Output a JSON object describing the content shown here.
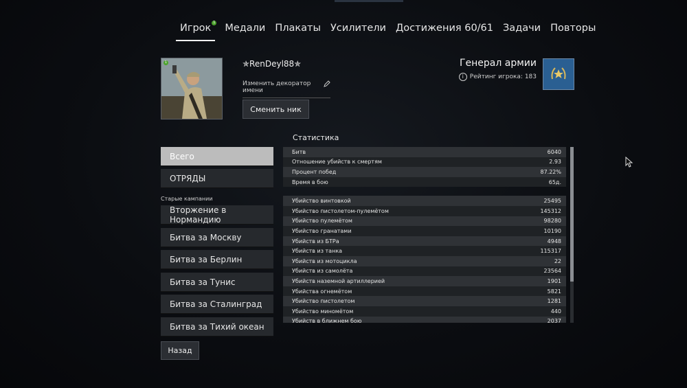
{
  "nav": {
    "tabs": [
      {
        "label": "Игрок",
        "active": true,
        "notification": "1"
      },
      {
        "label": "Медали"
      },
      {
        "label": "Плакаты"
      },
      {
        "label": "Усилители"
      },
      {
        "label": "Достижения 60/61"
      },
      {
        "label": "Задачи"
      },
      {
        "label": "Повторы"
      }
    ]
  },
  "profile": {
    "avatar_badge": "1",
    "username": "✯RenDeyl88✯",
    "decorator_label": "Изменить декоратор имени",
    "change_nick_label": "Сменить ник",
    "rank_title": "Генерал армии",
    "rating_text": "Рейтинг игрока: 183",
    "rank_color": "#2a5f92"
  },
  "sidebar": {
    "items": [
      {
        "label": "Всего",
        "active": true
      },
      {
        "label": "ОТРЯДЫ"
      }
    ],
    "old_campaigns_heading": "Старые кампании",
    "campaigns": [
      {
        "label": "Вторжение в Нормандию"
      },
      {
        "label": "Битва за Москву"
      },
      {
        "label": "Битва за Берлин"
      },
      {
        "label": "Битва за Тунис"
      },
      {
        "label": "Битва за Сталинград"
      },
      {
        "label": "Битва за Тихий океан"
      }
    ],
    "back_label": "Назад"
  },
  "stats": {
    "title": "Статистика",
    "group1": [
      {
        "label": "Битв",
        "value": "6040"
      },
      {
        "label": "Отношение убийств к смертям",
        "value": "2.93"
      },
      {
        "label": "Процент побед",
        "value": "87.22%"
      },
      {
        "label": "Время в бою",
        "value": "65д."
      }
    ],
    "group2": [
      {
        "label": "Убийство винтовкой",
        "value": "25495"
      },
      {
        "label": "Убийство пистолетом-пулемётом",
        "value": "145312"
      },
      {
        "label": "Убийство пулемётом",
        "value": "98280"
      },
      {
        "label": "Убийство гранатами",
        "value": "10190"
      },
      {
        "label": "Убийств из БТРа",
        "value": "4948"
      },
      {
        "label": "Убийств из танка",
        "value": "115317"
      },
      {
        "label": "Убийств из мотоцикла",
        "value": "22"
      },
      {
        "label": "Убийств из самолёта",
        "value": "23564"
      },
      {
        "label": "Убийств наземной артиллерией",
        "value": "1901"
      },
      {
        "label": "Убийства огнемётом",
        "value": "5821"
      },
      {
        "label": "Убийство пистолетом",
        "value": "1281"
      },
      {
        "label": "Убийство миномётом",
        "value": "440"
      },
      {
        "label": "Убийств в ближнем бою",
        "value": "2037"
      }
    ]
  }
}
